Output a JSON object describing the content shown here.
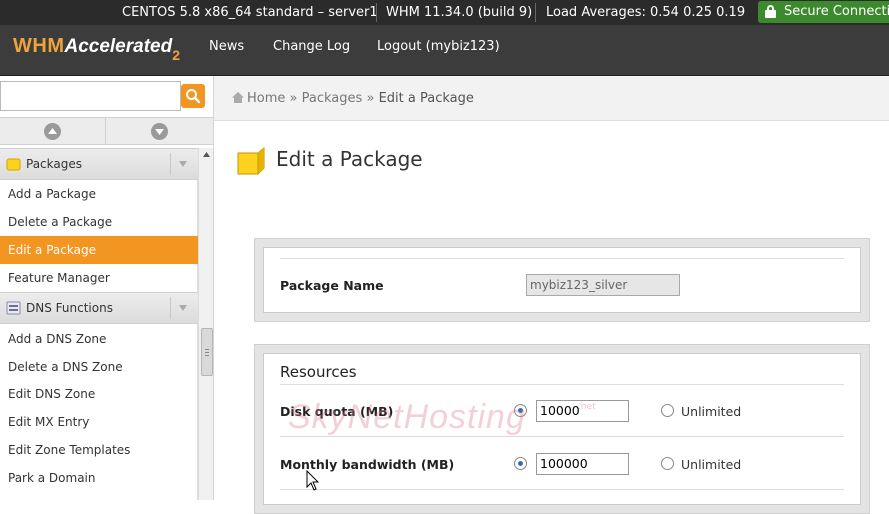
{
  "status_bar": {
    "server": "CENTOS 5.8 x86_64 standard – server1",
    "whm_version": "WHM 11.34.0 (build 9)",
    "load_averages": "Load Averages: 0.54 0.25 0.19",
    "secure": "Secure Connecti"
  },
  "nav": {
    "logo_whm": "WHM",
    "logo_accelerated": "Accelerated",
    "logo_version": "2",
    "links": [
      "News",
      "Change Log",
      "Logout (mybiz123)"
    ]
  },
  "search": {
    "value": "",
    "placeholder": ""
  },
  "sidebar": {
    "groups": [
      {
        "label": "Packages",
        "icon": "package-icon",
        "items": [
          "Add a Package",
          "Delete a Package",
          "Edit a Package",
          "Feature Manager"
        ],
        "active": "Edit a Package"
      },
      {
        "label": "DNS Functions",
        "icon": "dns-icon",
        "items": [
          "Add a DNS Zone",
          "Delete a DNS Zone",
          "Edit DNS Zone",
          "Edit MX Entry",
          "Edit Zone Templates",
          "Park a Domain"
        ]
      }
    ]
  },
  "breadcrumb": {
    "home": "Home",
    "sep": "»",
    "section": "Packages",
    "current": "Edit a Package"
  },
  "page": {
    "title": "Edit a Package"
  },
  "form": {
    "package_name_label": "Package Name",
    "package_name_value": "mybiz123_silver",
    "resources_title": "Resources",
    "disk_quota_label": "Disk quota (MB)",
    "disk_quota_value": "10000",
    "monthly_bw_label": "Monthly bandwidth (MB)",
    "monthly_bw_value": "100000",
    "unlimited_label": "Unlimited"
  },
  "watermark": {
    "text": "SkyNetHosting",
    "suffix": ".net"
  },
  "colors": {
    "accent": "#f39521",
    "secure_green": "#3d8a2e",
    "topbar": "#2b2b2b",
    "navbar": "#3c3c3c",
    "radio_selected": "#2f6fb3"
  }
}
